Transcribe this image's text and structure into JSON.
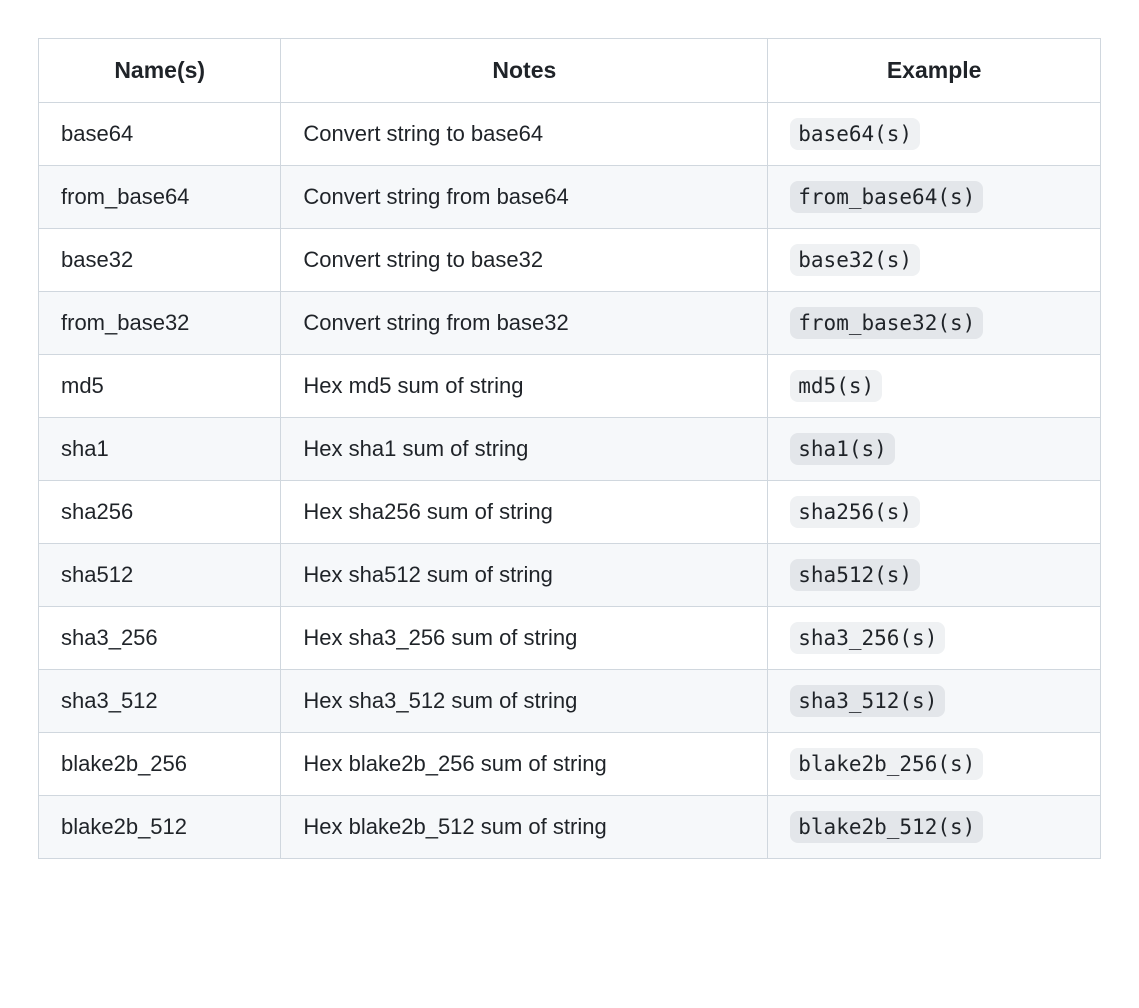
{
  "table": {
    "headers": [
      "Name(s)",
      "Notes",
      "Example"
    ],
    "rows": [
      {
        "name": "base64",
        "notes": "Convert string to base64",
        "example": "base64(s)"
      },
      {
        "name": "from_base64",
        "notes": "Convert string from base64",
        "example": "from_base64(s)"
      },
      {
        "name": "base32",
        "notes": "Convert string to base32",
        "example": "base32(s)"
      },
      {
        "name": "from_base32",
        "notes": "Convert string from base32",
        "example": "from_base32(s)"
      },
      {
        "name": "md5",
        "notes": "Hex md5 sum of string",
        "example": "md5(s)"
      },
      {
        "name": "sha1",
        "notes": "Hex sha1 sum of string",
        "example": "sha1(s)"
      },
      {
        "name": "sha256",
        "notes": "Hex sha256 sum of string",
        "example": "sha256(s)"
      },
      {
        "name": "sha512",
        "notes": "Hex sha512 sum of string",
        "example": "sha512(s)"
      },
      {
        "name": "sha3_256",
        "notes": "Hex sha3_256 sum of string",
        "example": "sha3_256(s)"
      },
      {
        "name": "sha3_512",
        "notes": "Hex sha3_512 sum of string",
        "example": "sha3_512(s)"
      },
      {
        "name": "blake2b_256",
        "notes": "Hex blake2b_256 sum of string",
        "example": "blake2b_256(s)"
      },
      {
        "name": "blake2b_512",
        "notes": "Hex blake2b_512 sum of string",
        "example": "blake2b_512(s)"
      }
    ]
  }
}
